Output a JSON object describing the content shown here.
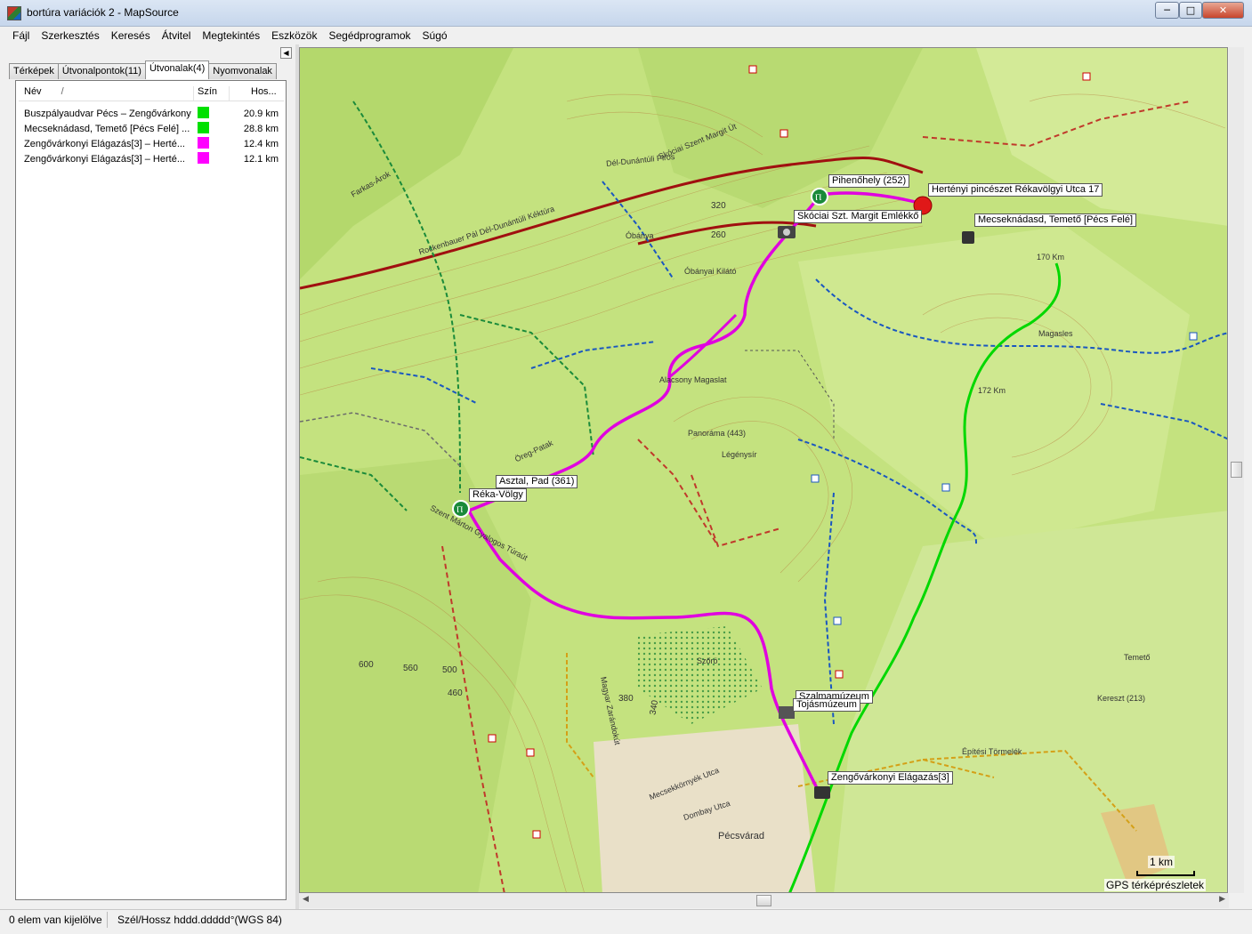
{
  "window": {
    "title": "bortúra variációk 2 - MapSource",
    "minimize": "─",
    "maximize": "□",
    "close": "✕"
  },
  "menu": [
    "Fájl",
    "Szerkesztés",
    "Keresés",
    "Átvitel",
    "Megtekintés",
    "Eszközök",
    "Segédprogramok",
    "Súgó"
  ],
  "panel": {
    "collapse": "◀",
    "tabs": [
      "Térképek",
      "Útvonalpontok(11)",
      "Útvonalak(4)",
      "Nyomvonalak"
    ],
    "active_tab": 2,
    "columns": {
      "name": "Név",
      "sort": "/",
      "color": "Szín",
      "length": "Hos..."
    },
    "rows": [
      {
        "name": "Buszpályaudvar Pécs – Zengővárkony ...",
        "color": "#00e000",
        "length": "20.9 km"
      },
      {
        "name": "Mecseknádasd, Temető [Pécs Felé] ...",
        "color": "#00e000",
        "length": "28.8 km"
      },
      {
        "name": "Zengővárkonyi Elágazás[3] – Herté...",
        "color": "#ff00ff",
        "length": "12.4 km"
      },
      {
        "name": "Zengővárkonyi Elágazás[3] – Herté...",
        "color": "#ff00ff",
        "length": "12.1 km"
      }
    ],
    "scroll_left": "◀",
    "scroll_right": "▶"
  },
  "map": {
    "labels": {
      "pihenohely": "Pihenőhely (252)",
      "hertenyi": "Hertényi pincészet Rékavölgyi Utca 17",
      "mecseknadasd": "Mecseknádasd, Temető [Pécs Felé]",
      "skociai": "Skóciai Szt. Margit Emlékkő",
      "asztal": "Asztal, Pad (361)",
      "reka": "Réka-Völgy",
      "szalma": "Szalmamúzeum",
      "tojas": "Tojásmúzeum",
      "zengo": "Zengővárkonyi Elágazás[3]"
    },
    "texts": {
      "t1": "Dél-Dunántúli Piros",
      "t2": "Skóciai Szent Margit Út",
      "t3": "Rockenbauer Pál Dél-Dunántúli Kéktúra",
      "t4": "Öreg-Patak",
      "t5": "Pécsvárad",
      "t6": "Panoráma (443)",
      "t7": "Alacsony Magaslat",
      "t8": "Magyar Zarándokút",
      "t9": "Óbányai Kilátó",
      "t10": "Szent Márton Gyalogos Túraút",
      "t11": "Farkas-Árok",
      "t12": "Légénysír",
      "t13": "170 Km",
      "t14": "172 Km",
      "t15": "Építési Törmelék",
      "t16": "320",
      "t17": "260",
      "t18": "380",
      "t19": "340",
      "t20": "560",
      "t21": "600",
      "t22": "500",
      "t23": "460",
      "t24": "Szőrö",
      "t25": "Óbánya",
      "t26": "Magasles",
      "t27": "Temető",
      "t28": "Kereszt (213)",
      "t29": "Dombay Utca",
      "t30": "Mecsekkörnyék Utca"
    },
    "scale": "1 km",
    "gps": "GPS térképrészletek"
  },
  "status": {
    "selection": "0 elem van kijelölve",
    "coords": "Szél/Hossz hddd.ddddd°(WGS 84)"
  }
}
